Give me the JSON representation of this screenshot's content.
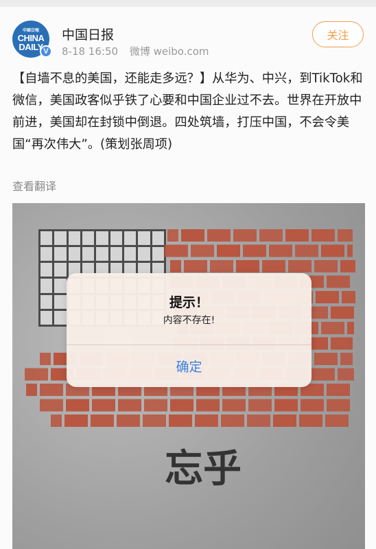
{
  "header": {
    "avatar_text_small": "中國日報",
    "avatar_line1": "CHINA",
    "avatar_line2": "DAILY",
    "verified_badge": "V",
    "username": "中国日报",
    "date": "8-18 16:50",
    "source": "微博 weibo.com",
    "follow_label": "关注"
  },
  "post": {
    "text": "【自墙不息的美国，还能走多远？】从华为、中兴，到TikTok和微信，美国政客似乎铁了心要和中国企业过不去。世界在开放中前进，美国却在封锁中倒退。四处筑墙，打压中国，不会令美国“再次伟大”。(策划张周项)",
    "translate_label": "查看翻译",
    "image_text": "忘乎"
  },
  "dialog": {
    "title": "提示！",
    "message": "内容不存在!",
    "confirm_label": "确定"
  },
  "colors": {
    "accent_orange": "#f29e46",
    "link_blue": "#3b82e0",
    "brick": "#b8553f"
  }
}
